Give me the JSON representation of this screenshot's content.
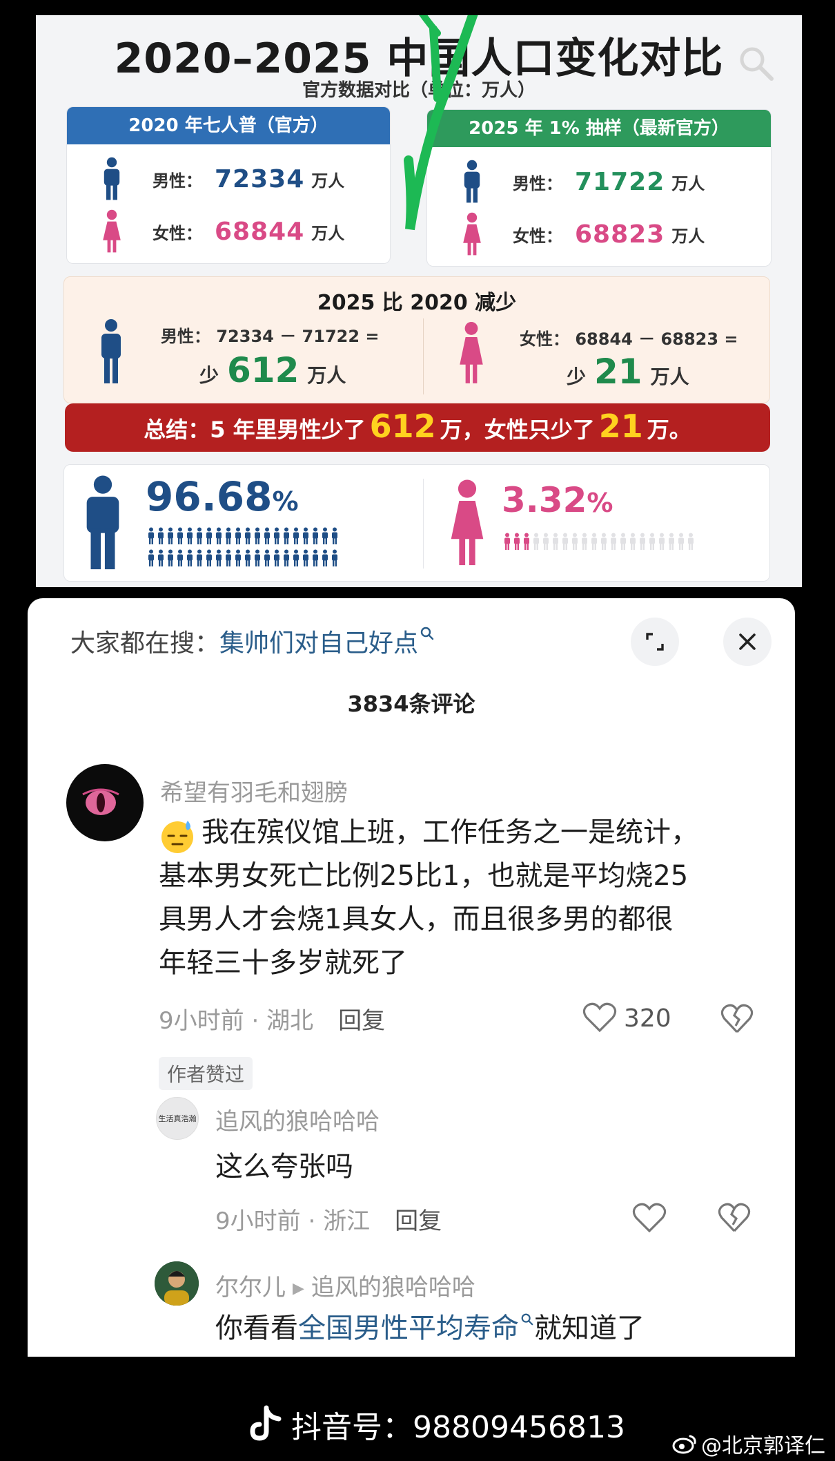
{
  "infographic": {
    "title": "2020–2025 中国人口变化对比",
    "subtitle": "官方数据对比（单位：万人）",
    "card_2020": {
      "header": "2020 年七人普（官方）",
      "male_label": "男性：",
      "male_value": "72334",
      "female_label": "女性：",
      "female_value": "68844",
      "unit": "万人"
    },
    "card_2025": {
      "header": "2025 年 1% 抽样（最新官方）",
      "male_label": "男性：",
      "male_value": "71722",
      "female_label": "女性：",
      "female_value": "68823",
      "unit": "万人"
    },
    "diff": {
      "title": "2025 比 2020 减少",
      "male_eq": "男性：  72334 － 71722 =",
      "male_prefix": "少",
      "male_value": "612",
      "female_eq": "女性：  68844 － 68823 =",
      "female_prefix": "少",
      "female_value": "21",
      "unit": "万人"
    },
    "summary": {
      "part1": "总结：5 年里男性少了",
      "num1": "612",
      "part2": "万，女性只少了",
      "num2": "21",
      "part3": "万。"
    },
    "share": {
      "male_pct": "96.68",
      "female_pct": "3.32",
      "pct_sign": "%"
    }
  },
  "comments_panel": {
    "search_label": "大家都在搜：",
    "search_term": "集帅们对自己好点",
    "count_text": "3834条评论",
    "comments": [
      {
        "user": "希望有羽毛和翅膀",
        "line1": "我在殡仪馆上班，工作任务之一是统计，",
        "line2": "基本男女死亡比例25比1，也就是平均烧25",
        "line3": "具男人才会烧1具女人，而且很多男的都很",
        "line4": "年轻三十多岁就死了",
        "time": "9小时前",
        "location": "湖北",
        "reply": "回复",
        "likes": "320",
        "badge": "作者赞过"
      },
      {
        "user": "追风的狼哈哈哈",
        "avatar_text": "生活真浩瀚",
        "text": "这么夸张吗",
        "time": "9小时前",
        "location": "浙江",
        "reply": "回复"
      },
      {
        "user": "尔尔儿",
        "reply_to": "追风的狼哈哈哈",
        "text_prefix": "你看看",
        "link_text": "全国男性平均寿命",
        "text_suffix": "就知道了"
      }
    ]
  },
  "watermarks": {
    "douyin": "抖音号：98809456813",
    "weibo": "@北京郭译仁"
  },
  "colors": {
    "male_blue": "#1f4e86",
    "female_pink": "#d94a86",
    "reduction_green": "#1f8a4c",
    "summary_red": "#b42020",
    "summary_yellow": "#ffd21f",
    "header_blue": "#2f6fb5",
    "header_green": "#2e9a5c"
  }
}
